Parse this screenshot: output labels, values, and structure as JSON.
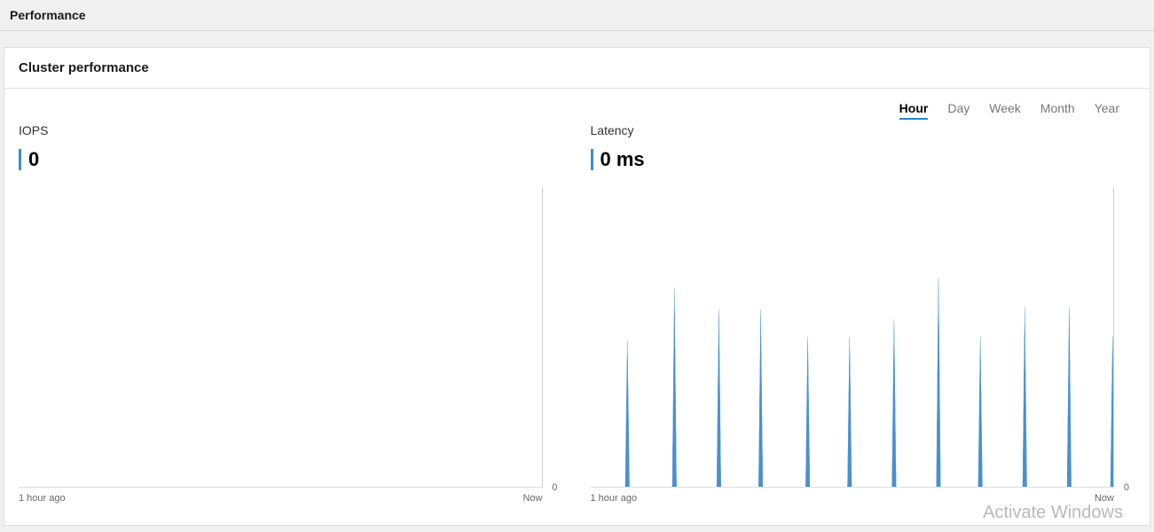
{
  "header": {
    "title": "Performance"
  },
  "panel": {
    "title": "Cluster performance"
  },
  "timeRange": {
    "tabs": [
      "Hour",
      "Day",
      "Week",
      "Month",
      "Year"
    ],
    "active": "Hour"
  },
  "iops": {
    "title": "IOPS",
    "value": "0",
    "axis": {
      "left": "1 hour ago",
      "right": "Now",
      "zero": "0"
    }
  },
  "latency": {
    "title": "Latency",
    "value": "0 ms",
    "axis": {
      "left": "1 hour ago",
      "right": "Now",
      "zero": "0"
    }
  },
  "watermark": "Activate Windows",
  "chart_data": [
    {
      "type": "line",
      "title": "IOPS",
      "xlabel": "",
      "ylabel": "",
      "x_range": [
        "1 hour ago",
        "Now"
      ],
      "ylim": [
        0,
        1
      ],
      "values": []
    },
    {
      "type": "bar",
      "title": "Latency",
      "xlabel": "",
      "ylabel": "",
      "x_range": [
        "1 hour ago",
        "Now"
      ],
      "ylim": [
        0,
        1
      ],
      "series": [
        {
          "name": "Latency",
          "x_fraction": [
            0.07,
            0.16,
            0.245,
            0.325,
            0.415,
            0.495,
            0.58,
            0.665,
            0.745,
            0.83,
            0.915,
            0.998
          ],
          "values_rel": [
            0.7,
            0.95,
            0.85,
            0.85,
            0.72,
            0.72,
            0.8,
            1.0,
            0.72,
            0.86,
            0.86,
            0.72
          ]
        }
      ]
    }
  ]
}
